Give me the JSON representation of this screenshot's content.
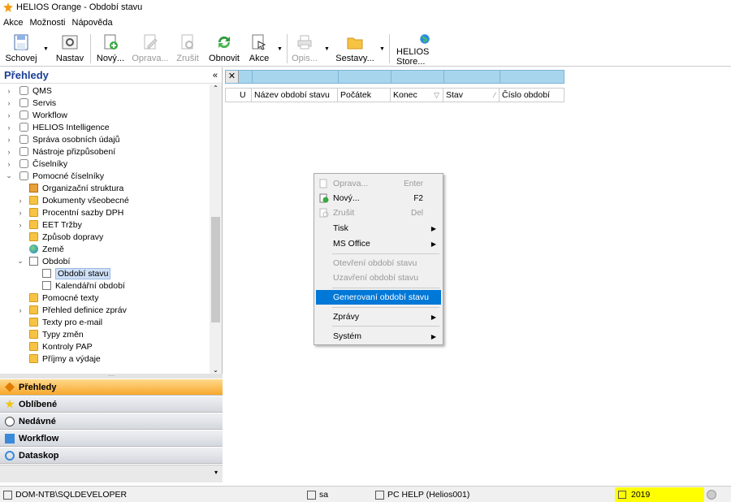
{
  "window": {
    "title": "HELIOS Orange - Období stavu"
  },
  "menu": [
    "Akce",
    "Možnosti",
    "Nápověda"
  ],
  "toolbar": {
    "save": "Schovej",
    "settings": "Nastav",
    "new": "Nový...",
    "edit": "Oprava...",
    "delete": "Zrušit",
    "refresh": "Obnovit",
    "actions": "Akce",
    "print": "Opis...",
    "reports": "Sestavy...",
    "store": "HELIOS Store..."
  },
  "left_panel": {
    "title": "Přehledy",
    "collapse": "«",
    "tree": [
      "QMS",
      "Servis",
      "Workflow",
      "HELIOS Intelligence",
      "Správa osobních údajů",
      "Nástroje přizpůsobení",
      "Číselníky",
      "Pomocné číselníky",
      "Organizační struktura",
      "Dokumenty všeobecné",
      "Procentní sazby DPH",
      "EET Tržby",
      "Způsob dopravy",
      "Země",
      "Období",
      "Období stavu",
      "Kalendářní období",
      "Pomocné texty",
      "Přehled definice zpráv",
      "Texty pro e-mail",
      "Typy změn",
      "Kontroly PAP",
      "Příjmy a výdaje"
    ]
  },
  "nav": [
    "Přehledy",
    "Oblíbené",
    "Nedávné",
    "Workflow",
    "Dataskop"
  ],
  "grid": {
    "columns": [
      "U",
      "Název období stavu",
      "Počátek",
      "Konec",
      "Stav",
      "Číslo období"
    ]
  },
  "context_menu": {
    "edit": "Oprava...",
    "edit_sc": "Enter",
    "new": "Nový...",
    "new_sc": "F2",
    "delete": "Zrušit",
    "delete_sc": "Del",
    "print": "Tisk",
    "msoffice": "MS Office",
    "open_period": "Otevření období stavu",
    "close_period": "Uzavření období stavu",
    "generate": "Generovaní období stavu",
    "reports": "Zprávy",
    "system": "Systém"
  },
  "status": {
    "server": "DOM-NTB\\SQLDEVELOPER",
    "user": "sa",
    "license": "PC HELP (Helios001)",
    "year": "2019"
  },
  "colors": {
    "accent": "#0078d7",
    "nav_active": "#f7a72c",
    "filter_row": "#a7d5ee",
    "year_highlight": "#ffff00"
  }
}
